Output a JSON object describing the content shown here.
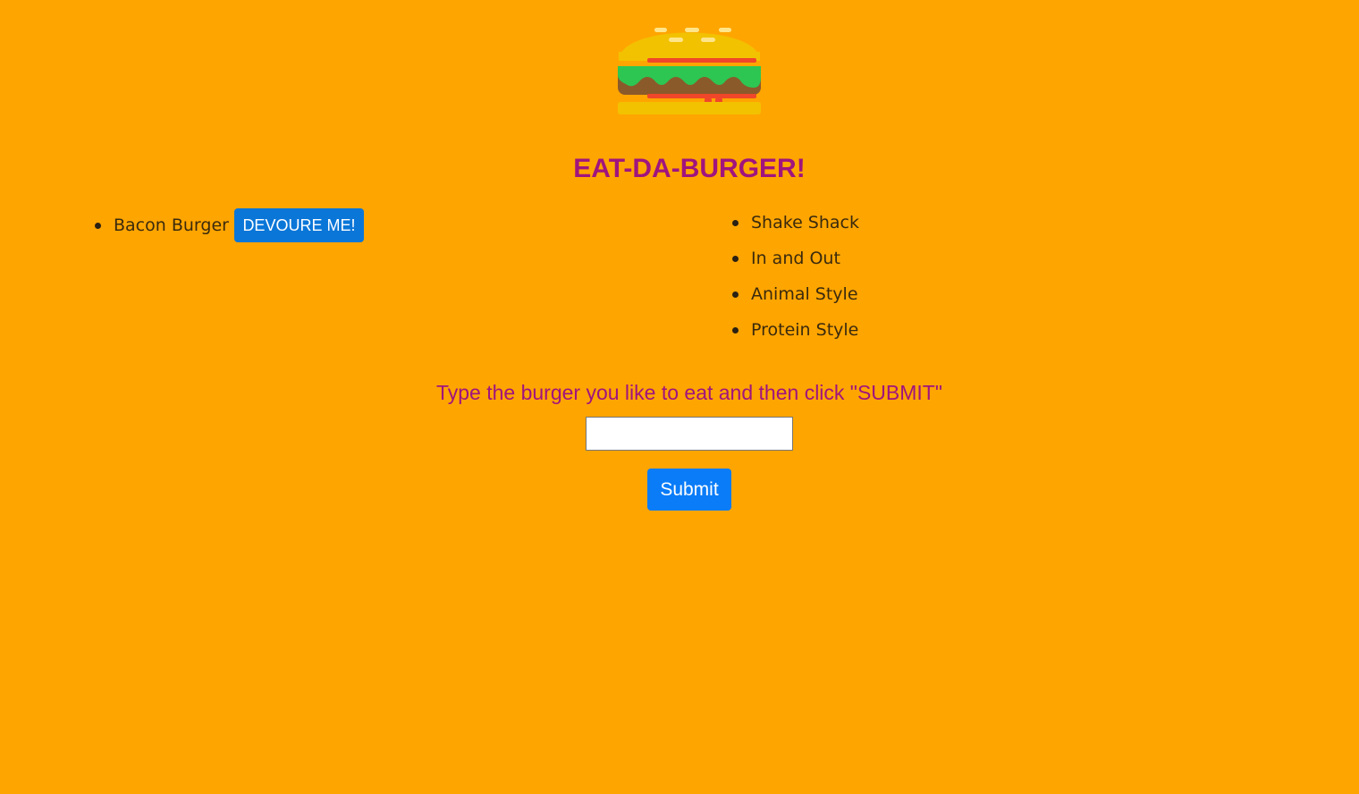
{
  "header": {
    "logo_icon": "burger-icon",
    "title": "EAT-DA-BURGER!",
    "title_color": "#A0147E"
  },
  "uneaten_burgers": [
    {
      "name": "Bacon Burger",
      "action_label": "DEVOURE ME!"
    }
  ],
  "devoured_burgers": [
    {
      "name": "Shake Shack"
    },
    {
      "name": "In and Out"
    },
    {
      "name": "Animal Style"
    },
    {
      "name": "Protein Style"
    }
  ],
  "form": {
    "prompt": "Type the burger you like to eat and then click \"SUBMIT\"",
    "input_value": "",
    "input_placeholder": "",
    "submit_label": "Submit"
  },
  "colors": {
    "background": "#FFA500",
    "button": "#0A76D8",
    "accent_text": "#A0147E"
  }
}
